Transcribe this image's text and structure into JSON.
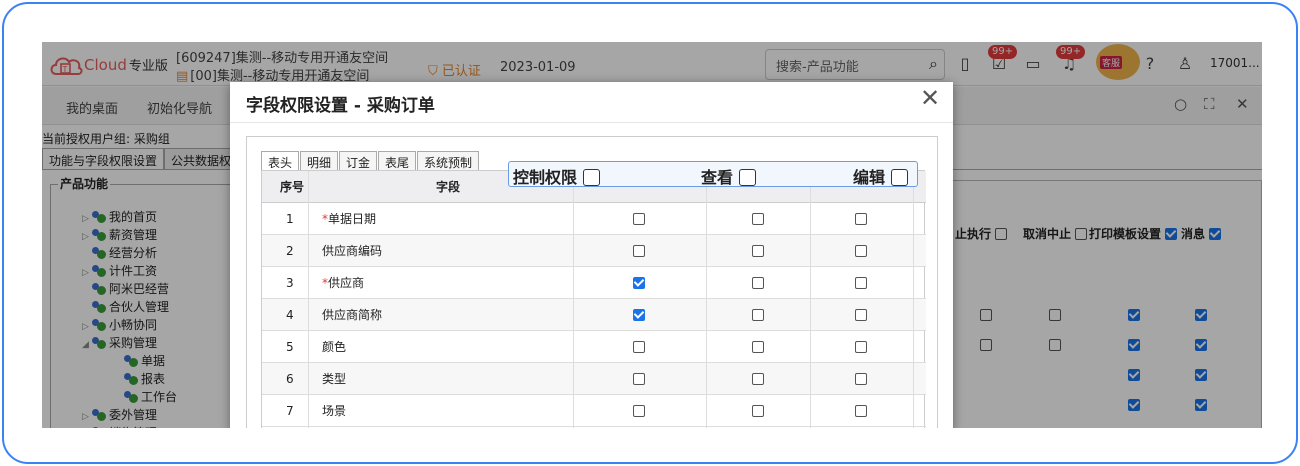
{
  "brand": {
    "name": "Cloud",
    "edition": "专业版"
  },
  "account": {
    "line1": "[609247]集测--移动专用开通友空间",
    "line2": "[00]集测--移动专用开通友空间",
    "certified": "已认证",
    "date": "2023-01-09"
  },
  "search": {
    "placeholder": "搜索-产品功能"
  },
  "badges": {
    "tasks": "99+",
    "notices": "99+"
  },
  "mascot_label": "客服",
  "user": "17001...",
  "nav": {
    "desktop": "我的桌面",
    "init_nav": "初始化导航"
  },
  "auth_group": "当前授权用户组:   采购组",
  "page_tabs": [
    "功能与字段权限设置",
    "公共数据权"
  ],
  "tree": {
    "legend": "产品功能",
    "items": [
      {
        "label": "我的首页"
      },
      {
        "label": "薪资管理"
      },
      {
        "label": "经营分析"
      },
      {
        "label": "计件工资"
      },
      {
        "label": "阿米巴经营"
      },
      {
        "label": "合伙人管理"
      },
      {
        "label": "小畅协同"
      },
      {
        "label": "采购管理"
      },
      {
        "label": "单据"
      },
      {
        "label": "报表"
      },
      {
        "label": "工作台"
      },
      {
        "label": "委外管理"
      },
      {
        "label": "销售管理"
      }
    ]
  },
  "background_columns": {
    "c1": "止执行",
    "c2": "取消中止",
    "c3": "打印模板设置",
    "c4": "消息"
  },
  "modal": {
    "title": "字段权限设置 - 采购订单",
    "tabs": [
      "表头",
      "明细",
      "订金",
      "表尾",
      "系统预制"
    ],
    "headers": {
      "index": "序号",
      "field": "字段"
    },
    "highlight": {
      "control": "控制权限",
      "view": "查看",
      "edit": "编辑"
    },
    "rows": [
      {
        "index": "1",
        "field": "单据日期",
        "required": true,
        "control": false,
        "view": false,
        "edit": false
      },
      {
        "index": "2",
        "field": "供应商编码",
        "required": false,
        "control": false,
        "view": false,
        "edit": false
      },
      {
        "index": "3",
        "field": "供应商",
        "required": true,
        "control": true,
        "view": false,
        "edit": false
      },
      {
        "index": "4",
        "field": "供应商简称",
        "required": false,
        "control": true,
        "view": false,
        "edit": false
      },
      {
        "index": "5",
        "field": "颜色",
        "required": false,
        "control": false,
        "view": false,
        "edit": false
      },
      {
        "index": "6",
        "field": "类型",
        "required": false,
        "control": false,
        "view": false,
        "edit": false
      },
      {
        "index": "7",
        "field": "场景",
        "required": false,
        "control": false,
        "view": false,
        "edit": false
      }
    ]
  },
  "colors": {
    "accent": "#3b82f6",
    "check": "#1a73e8",
    "required": "#e23b3b",
    "brand": "#e8842a"
  }
}
